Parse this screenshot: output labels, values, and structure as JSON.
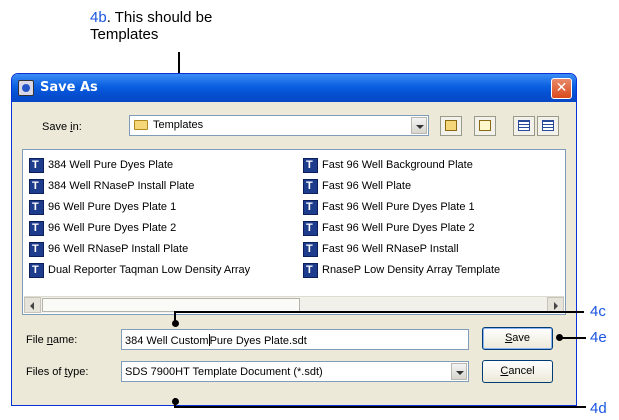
{
  "annotations": {
    "top_num": "4b",
    "top_text": ". This should be",
    "top_line2": "Templates",
    "c": "4c",
    "d": "4d",
    "e": "4e"
  },
  "dialog": {
    "title": "Save As",
    "save_in_label_pre": "Save ",
    "save_in_label_accel": "i",
    "save_in_label_post": "n:",
    "save_in_value": "Templates",
    "file_name_label_pre": "File ",
    "file_name_label_accel": "n",
    "file_name_label_post": "ame:",
    "file_name_value_pre": "384 Well Custom",
    "file_name_value_post": "Pure Dyes Plate.sdt",
    "file_type_label_pre": "Files of ",
    "file_type_label_accel": "t",
    "file_type_label_post": "ype:",
    "file_type_value": "SDS 7900HT Template Document (*.sdt)",
    "save_pre": "",
    "save_accel": "S",
    "save_post": "ave",
    "cancel_pre": "",
    "cancel_accel": "C",
    "cancel_post": "ancel"
  },
  "files": [
    "384 Well Pure Dyes Plate",
    "384 Well RNaseP Install Plate",
    "96 Well Pure Dyes Plate 1",
    "96 Well Pure Dyes Plate 2",
    "96 Well RNaseP Install Plate",
    "Dual Reporter Taqman Low Density Array",
    "Fast 96 Well Background Plate",
    "Fast 96 Well Plate",
    "Fast 96 Well Pure Dyes Plate 1",
    "Fast 96 Well Pure Dyes Plate 2",
    "Fast 96 Well RNaseP Install",
    "RnaseP Low Density Array Template"
  ],
  "colors": {
    "annotation_blue": "#1a56e0",
    "titlebar_blue": "#0a5fe0",
    "dialog_face": "#ece9d8"
  }
}
